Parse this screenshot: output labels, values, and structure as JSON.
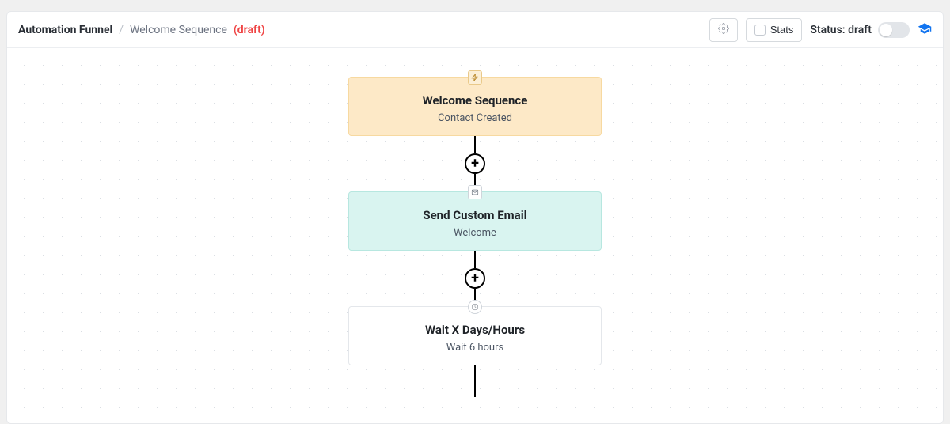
{
  "header": {
    "breadcrumb_main": "Automation Funnel",
    "breadcrumb_sep": "/",
    "breadcrumb_sub": "Welcome Sequence",
    "breadcrumb_draft": "(draft)",
    "stats_label": "Stats",
    "status_label": "Status: draft"
  },
  "flow": {
    "trigger": {
      "title": "Welcome Sequence",
      "subtitle": "Contact Created"
    },
    "email": {
      "title": "Send Custom Email",
      "subtitle": "Welcome"
    },
    "wait": {
      "title": "Wait X Days/Hours",
      "subtitle": "Wait 6 hours"
    }
  }
}
